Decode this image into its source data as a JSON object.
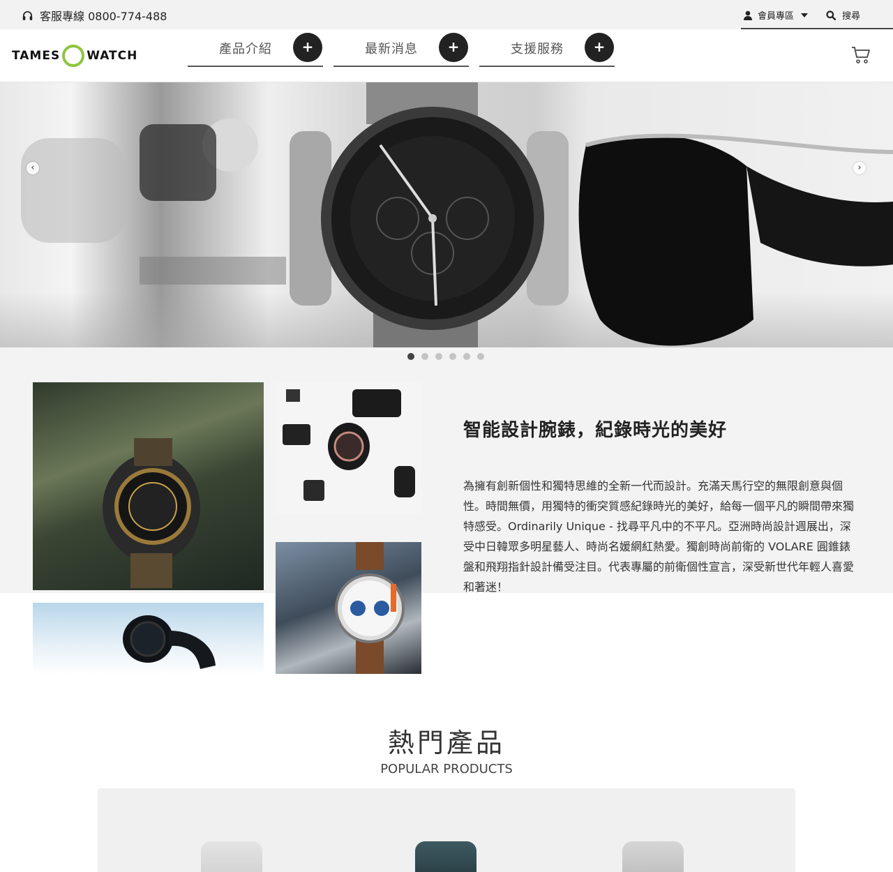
{
  "topbar": {
    "hotline_label": "客服專線 0800-774-488",
    "member_label": "會員專區",
    "search_label": "搜尋"
  },
  "header": {
    "logo_left": "TAMES",
    "logo_right": "WATCH",
    "nav": [
      {
        "label": "產品介紹",
        "toggle": "+"
      },
      {
        "label": "最新消息",
        "toggle": "+"
      },
      {
        "label": "支援服務",
        "toggle": "+"
      }
    ]
  },
  "hero": {
    "prev": "‹",
    "next": "›",
    "slide_count": 6,
    "active_slide": 1
  },
  "about": {
    "title": "智能設計腕錶，紀錄時光的美好",
    "body": "為擁有創新個性和獨特思維的全新一代而設計。充滿天馬行空的無限創意與個性。時間無價，用獨特的衝突質感紀錄時光的美好，給每一個平凡的瞬間帶來獨特感受。Ordinarily Unique - 找尋平凡中的不平凡。亞洲時尚設計週展出，深受中日韓眾多明星藝人、時尚名媛網紅熱愛。獨創時尚前衛的 VOLARE 圓錐錶盤和飛翔指針設計備受注目。代表專屬的前衛個性宣言，深受新世代年輕人喜愛和著迷！"
  },
  "popular": {
    "title": "熱門產品",
    "subtitle": "POPULAR PRODUCTS"
  },
  "colors": {
    "accent_green": "#8dc63f",
    "dark": "#222222",
    "band": "#f3f3f3"
  }
}
